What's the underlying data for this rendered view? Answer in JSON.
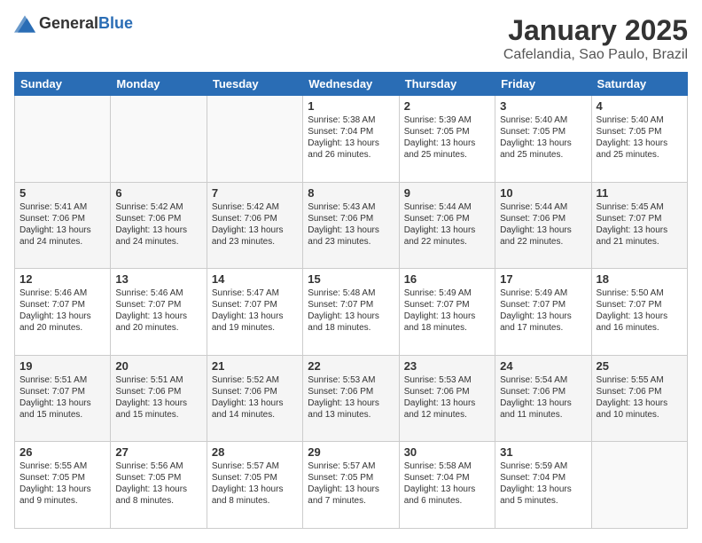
{
  "header": {
    "logo_general": "General",
    "logo_blue": "Blue",
    "title": "January 2025",
    "location": "Cafelandia, Sao Paulo, Brazil"
  },
  "days_of_week": [
    "Sunday",
    "Monday",
    "Tuesday",
    "Wednesday",
    "Thursday",
    "Friday",
    "Saturday"
  ],
  "weeks": [
    [
      {
        "day": "",
        "text": ""
      },
      {
        "day": "",
        "text": ""
      },
      {
        "day": "",
        "text": ""
      },
      {
        "day": "1",
        "text": "Sunrise: 5:38 AM\nSunset: 7:04 PM\nDaylight: 13 hours\nand 26 minutes."
      },
      {
        "day": "2",
        "text": "Sunrise: 5:39 AM\nSunset: 7:05 PM\nDaylight: 13 hours\nand 25 minutes."
      },
      {
        "day": "3",
        "text": "Sunrise: 5:40 AM\nSunset: 7:05 PM\nDaylight: 13 hours\nand 25 minutes."
      },
      {
        "day": "4",
        "text": "Sunrise: 5:40 AM\nSunset: 7:05 PM\nDaylight: 13 hours\nand 25 minutes."
      }
    ],
    [
      {
        "day": "5",
        "text": "Sunrise: 5:41 AM\nSunset: 7:06 PM\nDaylight: 13 hours\nand 24 minutes."
      },
      {
        "day": "6",
        "text": "Sunrise: 5:42 AM\nSunset: 7:06 PM\nDaylight: 13 hours\nand 24 minutes."
      },
      {
        "day": "7",
        "text": "Sunrise: 5:42 AM\nSunset: 7:06 PM\nDaylight: 13 hours\nand 23 minutes."
      },
      {
        "day": "8",
        "text": "Sunrise: 5:43 AM\nSunset: 7:06 PM\nDaylight: 13 hours\nand 23 minutes."
      },
      {
        "day": "9",
        "text": "Sunrise: 5:44 AM\nSunset: 7:06 PM\nDaylight: 13 hours\nand 22 minutes."
      },
      {
        "day": "10",
        "text": "Sunrise: 5:44 AM\nSunset: 7:06 PM\nDaylight: 13 hours\nand 22 minutes."
      },
      {
        "day": "11",
        "text": "Sunrise: 5:45 AM\nSunset: 7:07 PM\nDaylight: 13 hours\nand 21 minutes."
      }
    ],
    [
      {
        "day": "12",
        "text": "Sunrise: 5:46 AM\nSunset: 7:07 PM\nDaylight: 13 hours\nand 20 minutes."
      },
      {
        "day": "13",
        "text": "Sunrise: 5:46 AM\nSunset: 7:07 PM\nDaylight: 13 hours\nand 20 minutes."
      },
      {
        "day": "14",
        "text": "Sunrise: 5:47 AM\nSunset: 7:07 PM\nDaylight: 13 hours\nand 19 minutes."
      },
      {
        "day": "15",
        "text": "Sunrise: 5:48 AM\nSunset: 7:07 PM\nDaylight: 13 hours\nand 18 minutes."
      },
      {
        "day": "16",
        "text": "Sunrise: 5:49 AM\nSunset: 7:07 PM\nDaylight: 13 hours\nand 18 minutes."
      },
      {
        "day": "17",
        "text": "Sunrise: 5:49 AM\nSunset: 7:07 PM\nDaylight: 13 hours\nand 17 minutes."
      },
      {
        "day": "18",
        "text": "Sunrise: 5:50 AM\nSunset: 7:07 PM\nDaylight: 13 hours\nand 16 minutes."
      }
    ],
    [
      {
        "day": "19",
        "text": "Sunrise: 5:51 AM\nSunset: 7:07 PM\nDaylight: 13 hours\nand 15 minutes."
      },
      {
        "day": "20",
        "text": "Sunrise: 5:51 AM\nSunset: 7:06 PM\nDaylight: 13 hours\nand 15 minutes."
      },
      {
        "day": "21",
        "text": "Sunrise: 5:52 AM\nSunset: 7:06 PM\nDaylight: 13 hours\nand 14 minutes."
      },
      {
        "day": "22",
        "text": "Sunrise: 5:53 AM\nSunset: 7:06 PM\nDaylight: 13 hours\nand 13 minutes."
      },
      {
        "day": "23",
        "text": "Sunrise: 5:53 AM\nSunset: 7:06 PM\nDaylight: 13 hours\nand 12 minutes."
      },
      {
        "day": "24",
        "text": "Sunrise: 5:54 AM\nSunset: 7:06 PM\nDaylight: 13 hours\nand 11 minutes."
      },
      {
        "day": "25",
        "text": "Sunrise: 5:55 AM\nSunset: 7:06 PM\nDaylight: 13 hours\nand 10 minutes."
      }
    ],
    [
      {
        "day": "26",
        "text": "Sunrise: 5:55 AM\nSunset: 7:05 PM\nDaylight: 13 hours\nand 9 minutes."
      },
      {
        "day": "27",
        "text": "Sunrise: 5:56 AM\nSunset: 7:05 PM\nDaylight: 13 hours\nand 8 minutes."
      },
      {
        "day": "28",
        "text": "Sunrise: 5:57 AM\nSunset: 7:05 PM\nDaylight: 13 hours\nand 8 minutes."
      },
      {
        "day": "29",
        "text": "Sunrise: 5:57 AM\nSunset: 7:05 PM\nDaylight: 13 hours\nand 7 minutes."
      },
      {
        "day": "30",
        "text": "Sunrise: 5:58 AM\nSunset: 7:04 PM\nDaylight: 13 hours\nand 6 minutes."
      },
      {
        "day": "31",
        "text": "Sunrise: 5:59 AM\nSunset: 7:04 PM\nDaylight: 13 hours\nand 5 minutes."
      },
      {
        "day": "",
        "text": ""
      }
    ]
  ]
}
